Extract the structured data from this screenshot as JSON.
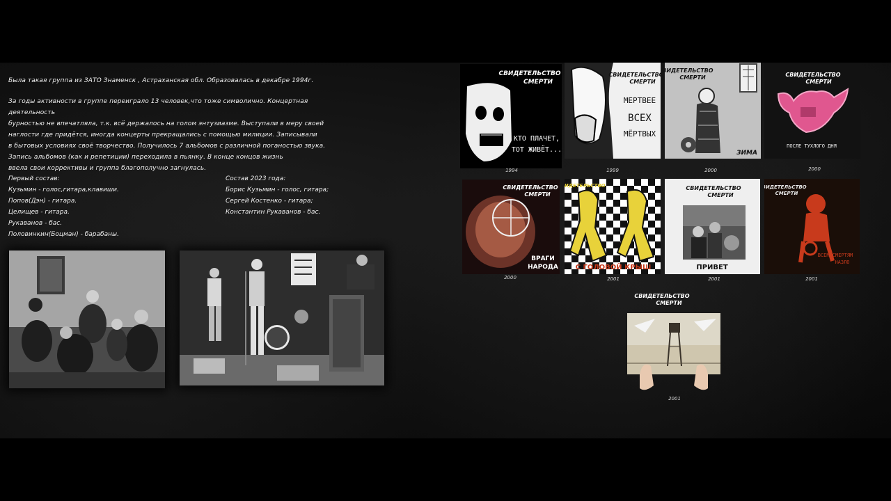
{
  "bio": {
    "p1": "Была такая группа из ЗАТО Знаменск , Астраханская обл. Образовалась в декабре 1994г.",
    "p2_lines": [
      "За годы активности в группе переиграло 13 человек,что тоже символично. Концертная деятельность",
      "бурностью не впечатляла, т.к. всё держалось на голом энтузиазме. Выступали в меру своей",
      "наглости где придётся, иногда концерты прекращались с помощью милиции. Записывали",
      "в бытовых условиях своё творчество. Получилось 7 альбомов с различной поганостью звука.",
      "Запись альбомов (как и репетиции) переходила в пьянку. В конце концов жизнь",
      "ввела свои коррективы и группа благополучно загнулась."
    ]
  },
  "lineup_first": {
    "title": "Первый состав:",
    "members": [
      "Кузьмин - голос,гитара,клавиши.",
      "Попов(Дэн) - гитара.",
      "Целищев - гитара.",
      "Рукаванов - бас.",
      "Половинкин(Боцман) - барабаны."
    ]
  },
  "lineup_2023": {
    "title": "Состав 2023 года:",
    "members": [
      "Борис Кузьмин - голос, гитара;",
      "Сергей Костенко - гитара;",
      "Константин Рукаванов - бас."
    ]
  },
  "band_logo": {
    "line1": "СВИДЕТЕЛЬСТВО",
    "line2": "СМЕРТИ"
  },
  "albums": [
    {
      "title_lines": [
        "КТО ПЛАЧЕТ,",
        "ТОТ ЖИВЁТ..."
      ],
      "year": "1994"
    },
    {
      "title_lines": [
        "МЕРТВЕЕ",
        "ВСЕХ",
        "МЁРТВЫХ"
      ],
      "year": "1999"
    },
    {
      "title_lines": [
        "ЗИМА"
      ],
      "year": "2000"
    },
    {
      "title_lines": [
        "ПОСЛЕ ТУХЛОГО ДНЯ"
      ],
      "year": "2000"
    },
    {
      "title_lines": [
        "ВРАГИ",
        "НАРОДА"
      ],
      "year": "2000"
    },
    {
      "title_lines": [
        "С ГОЛОВОЙ КРЫШ"
      ],
      "year": "2001"
    },
    {
      "title_lines": [
        "ПРИВЕТ"
      ],
      "year": "2001"
    },
    {
      "title_lines": [
        "ВСЕМ СМЕРТЯМ",
        "НАЗЛО"
      ],
      "year": "2001"
    },
    {
      "title_lines": [],
      "year": "2001"
    }
  ],
  "colors": {
    "accent_pink": "#e0578f",
    "accent_red": "#c83a1c",
    "yellow": "#e8d23a"
  }
}
